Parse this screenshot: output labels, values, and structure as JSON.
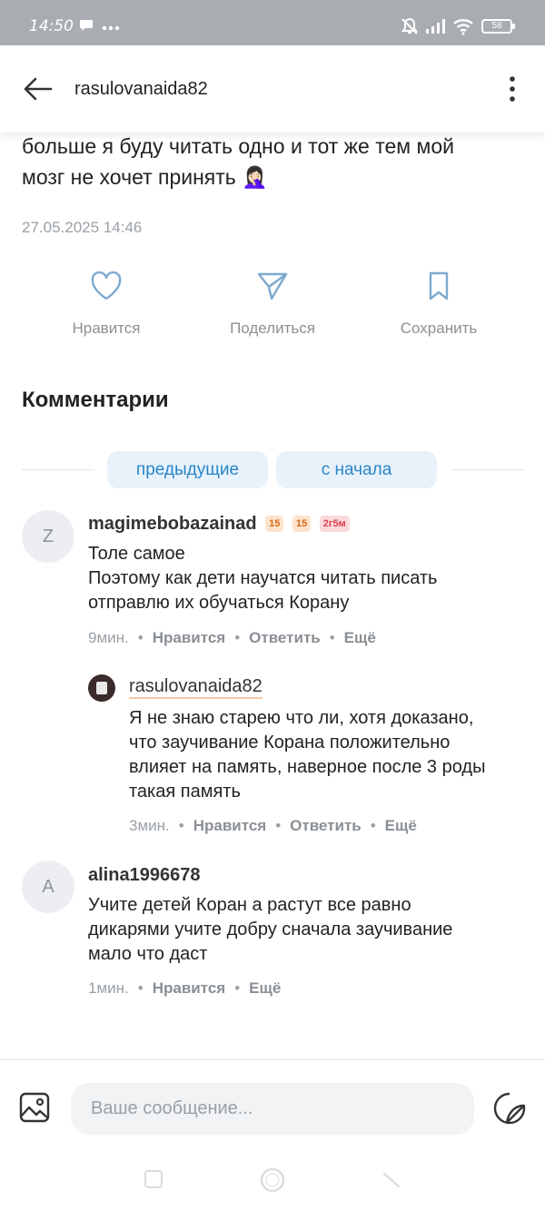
{
  "status_bar": {
    "time": "14:50",
    "battery": "58"
  },
  "header": {
    "title": "rasulovanaida82"
  },
  "post": {
    "text_line1": "больше я буду читать одно и тот же тем мой",
    "text_line2": "мозг не хочет принять 🤦🏻‍♀️",
    "date": "27.05.2025 14:46"
  },
  "actions": {
    "like": "Нравится",
    "share": "Поделиться",
    "save": "Сохранить"
  },
  "comments": {
    "title": "Комментарии",
    "pager": {
      "previous": "предыдущие",
      "from_start": "с начала"
    },
    "items": [
      {
        "avatar_letter": "Z",
        "author": "magimebobazainad",
        "badges": [
          "15",
          "15",
          "2г5м"
        ],
        "line1": "Толе самое",
        "line2": "Поэтому как дети научатся читать писать",
        "line3": "отправлю их обучаться Корану",
        "time": "9мин.",
        "like": "Нравится",
        "reply": "Ответить",
        "more": "Ещё"
      },
      {
        "author": "rasulovanaida82",
        "line1": "Я не знаю старею что ли, хотя доказано,",
        "line2": "что заучивание Корана положительно",
        "line3": "влияет на память, наверное после 3 роды",
        "line4": "такая память",
        "time": "3мин.",
        "like": "Нравится",
        "reply": "Ответить",
        "more": "Ещё"
      },
      {
        "avatar_letter": "A",
        "author": "alina1996678",
        "line1": "Учите детей Коран а растут все равно",
        "line2": "дикарями учите добру сначала заучивание",
        "line3": "мало что даст",
        "time": "1мин.",
        "like": "Нравится",
        "more": "Ещё"
      }
    ]
  },
  "composer": {
    "placeholder": "Ваше сообщение..."
  }
}
